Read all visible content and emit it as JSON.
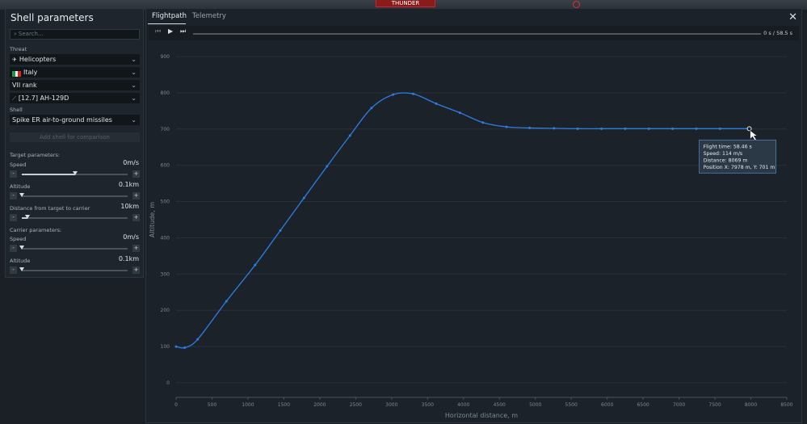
{
  "header": {
    "badge_text": "THUNDER"
  },
  "left_panel": {
    "title": "Shell parameters",
    "search_placeholder": "Search...",
    "threat_label": "Threat",
    "threat_type": "Helicopters",
    "country": "Italy",
    "rank": "VII rank",
    "vehicle": "[12.7] AH-129D",
    "shell_label": "Shell",
    "shell": "Spike ER air-to-ground missiles",
    "add_shell_label": "Add shell for comparison",
    "target_params_label": "Target parameters:",
    "carrier_params_label": "Carrier parameters:",
    "target": {
      "speed": {
        "label": "Speed",
        "value": "0m/s",
        "level": 0.5
      },
      "altitude": {
        "label": "Altitude",
        "value": "0.1km",
        "level": 0.0
      },
      "distance": {
        "label": "Distance from target to carrier",
        "value": "10km",
        "level": 0.05
      }
    },
    "carrier": {
      "speed": {
        "label": "Speed",
        "value": "0m/s",
        "level": 0.0
      },
      "altitude": {
        "label": "Altitude",
        "value": "0.1km",
        "level": 0.0
      }
    },
    "slider_minus": "-",
    "slider_plus": "+"
  },
  "right_panel": {
    "tabs": [
      {
        "label": "Flightpath",
        "active": true
      },
      {
        "label": "Telemetry",
        "active": false
      }
    ],
    "close_label": "✕",
    "playback": {
      "prev": "⏮",
      "play": "▶",
      "next": "⏭",
      "time_text": "0 s  /  58.5 s",
      "progress": 0.0
    }
  },
  "chart_data": {
    "type": "line",
    "xlabel": "Horizontal distance, m",
    "ylabel": "Altitude, m",
    "xlim": [
      0,
      8500
    ],
    "ylim": [
      0,
      900
    ],
    "x_ticks": [
      0,
      500,
      1000,
      1500,
      2000,
      2500,
      3000,
      3500,
      4000,
      4500,
      5000,
      5500,
      6000,
      6500,
      7000,
      7500,
      8000,
      8500
    ],
    "y_ticks": [
      0,
      100,
      200,
      300,
      400,
      500,
      600,
      700,
      800,
      900
    ],
    "grid": true,
    "series": [
      {
        "color": "#2f7de1",
        "x": [
          0,
          120,
          300,
          700,
          1100,
          1450,
          1780,
          2100,
          2420,
          2720,
          3020,
          3300,
          3620,
          3950,
          4270,
          4600,
          4920,
          5260,
          5590,
          5920,
          6250,
          6580,
          6910,
          7240,
          7570,
          7978
        ],
        "y": [
          100,
          97,
          120,
          225,
          325,
          420,
          510,
          597,
          682,
          758,
          795,
          797,
          770,
          745,
          718,
          706,
          703,
          702,
          701,
          701,
          701,
          701,
          701,
          701,
          701,
          701
        ]
      }
    ],
    "tooltip": {
      "lines": [
        "Flight time: 58.46 s",
        "Speed: 114 m/s",
        "Distance: 8069 m",
        "Position X: 7978 m, Y: 701 m"
      ]
    }
  }
}
